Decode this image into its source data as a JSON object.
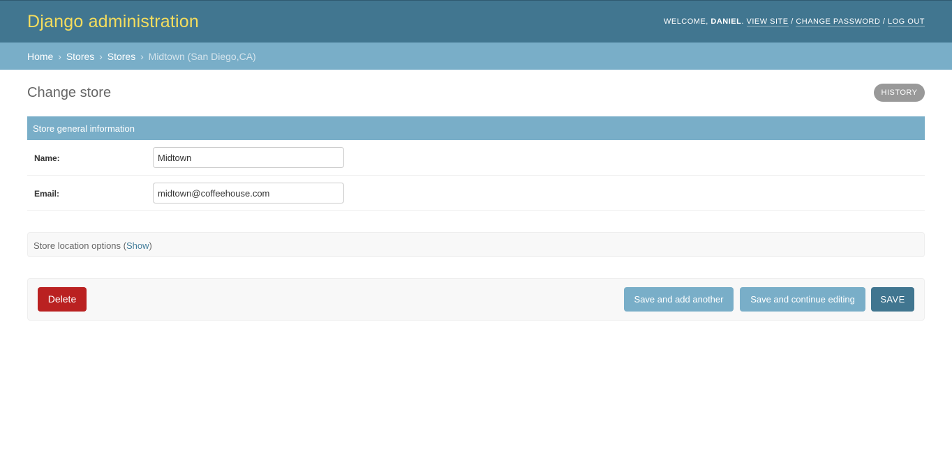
{
  "header": {
    "branding": "Django administration",
    "welcome_prefix": "WELCOME, ",
    "username": "DANIEL",
    "welcome_suffix": ".",
    "view_site": "VIEW SITE",
    "change_password": "CHANGE PASSWORD",
    "log_out": "LOG OUT",
    "separator": "/"
  },
  "breadcrumbs": {
    "separator": "›",
    "items": [
      "Home",
      "Stores",
      "Stores"
    ],
    "current": "Midtown (San Diego,CA)"
  },
  "content": {
    "title": "Change store",
    "history_label": "HISTORY"
  },
  "fieldset_general": {
    "title": "Store general information",
    "fields": [
      {
        "label": "Name:",
        "value": "Midtown"
      },
      {
        "label": "Email:",
        "value": "midtown@coffeehouse.com"
      }
    ]
  },
  "fieldset_location": {
    "title": "Store location options (",
    "toggle_label": "Show",
    "title_close": ")"
  },
  "submit_row": {
    "delete_label": "Delete",
    "save_add_another_label": "Save and add another",
    "save_continue_label": "Save and continue editing",
    "save_label": "SAVE"
  },
  "colors": {
    "header_bg": "#417690",
    "branding": "#f5dd5d",
    "breadcrumbs_bg": "#79aec8",
    "delete_button": "#ba2121",
    "save_button": "#417690",
    "secondary_button": "#79aec8"
  }
}
